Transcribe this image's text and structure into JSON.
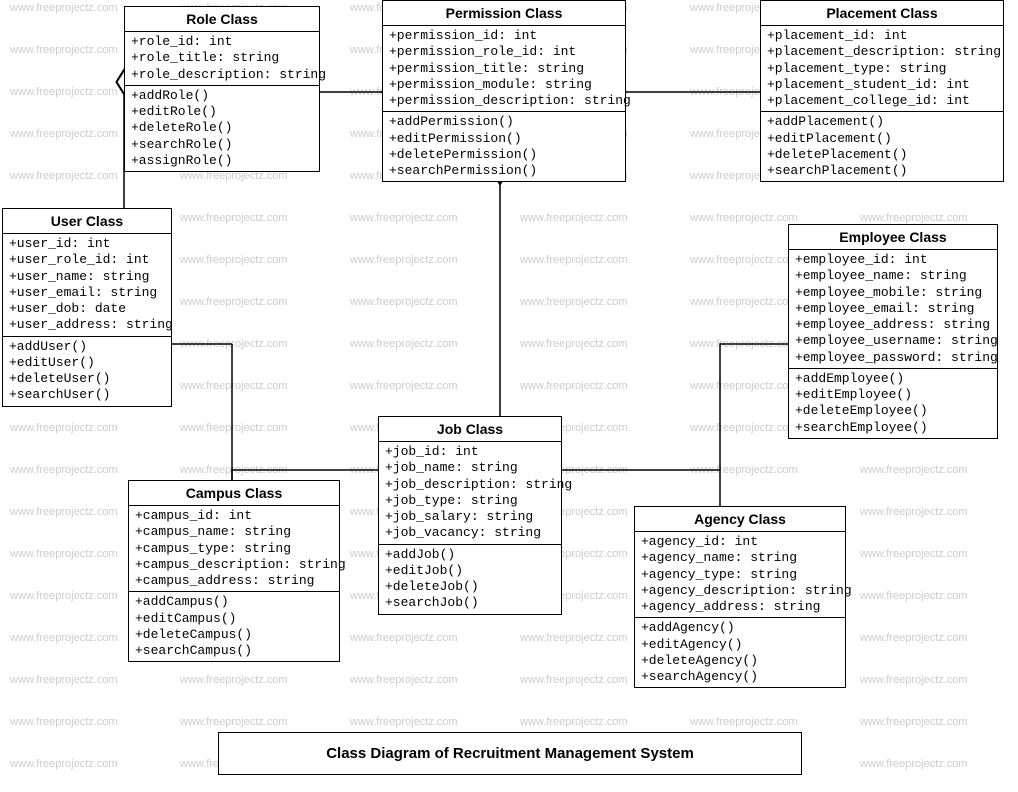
{
  "title": "Class Diagram of Recruitment Management System",
  "watermark_text": "www.freeprojectz.com",
  "classes": {
    "role": {
      "name": "Role Class",
      "attrs": [
        "+role_id: int",
        "+role_title: string",
        "+role_description: string"
      ],
      "methods": [
        "+addRole()",
        "+editRole()",
        "+deleteRole()",
        "+searchRole()",
        "+assignRole()"
      ]
    },
    "permission": {
      "name": "Permission Class",
      "attrs": [
        "+permission_id: int",
        "+permission_role_id: int",
        "+permission_title: string",
        "+permission_module: string",
        "+permission_description: string"
      ],
      "methods": [
        "+addPermission()",
        "+editPermission()",
        "+deletePermission()",
        "+searchPermission()"
      ]
    },
    "placement": {
      "name": "Placement Class",
      "attrs": [
        "+placement_id: int",
        "+placement_description: string",
        "+placement_type: string",
        "+placement_student_id: int",
        "+placement_college_id: int"
      ],
      "methods": [
        "+addPlacement()",
        "+editPlacement()",
        "+deletePlacement()",
        "+searchPlacement()"
      ]
    },
    "user": {
      "name": "User Class",
      "attrs": [
        "+user_id: int",
        "+user_role_id: int",
        "+user_name: string",
        "+user_email: string",
        "+user_dob: date",
        "+user_address: string"
      ],
      "methods": [
        "+addUser()",
        "+editUser()",
        "+deleteUser()",
        "+searchUser()"
      ]
    },
    "employee": {
      "name": "Employee Class",
      "attrs": [
        "+employee_id: int",
        "+employee_name: string",
        "+employee_mobile: string",
        "+employee_email: string",
        "+employee_address: string",
        "+employee_username: string",
        "+employee_password: string"
      ],
      "methods": [
        "+addEmployee()",
        "+editEmployee()",
        "+deleteEmployee()",
        "+searchEmployee()"
      ]
    },
    "job": {
      "name": "Job Class",
      "attrs": [
        "+job_id: int",
        "+job_name: string",
        "+job_description: string",
        "+job_type: string",
        "+job_salary: string",
        "+job_vacancy: string"
      ],
      "methods": [
        "+addJob()",
        "+editJob()",
        "+deleteJob()",
        "+searchJob()"
      ]
    },
    "campus": {
      "name": "Campus Class",
      "attrs": [
        "+campus_id: int",
        "+campus_name: string",
        "+campus_type: string",
        "+campus_description: string",
        "+campus_address: string"
      ],
      "methods": [
        "+addCampus()",
        "+editCampus()",
        "+deleteCampus()",
        "+searchCampus()"
      ]
    },
    "agency": {
      "name": "Agency Class",
      "attrs": [
        "+agency_id: int",
        "+agency_name: string",
        "+agency_type: string",
        "+agency_description: string",
        "+agency_address: string"
      ],
      "methods": [
        "+addAgency()",
        "+editAgency()",
        "+deleteAgency()",
        "+searchAgency()"
      ]
    }
  }
}
